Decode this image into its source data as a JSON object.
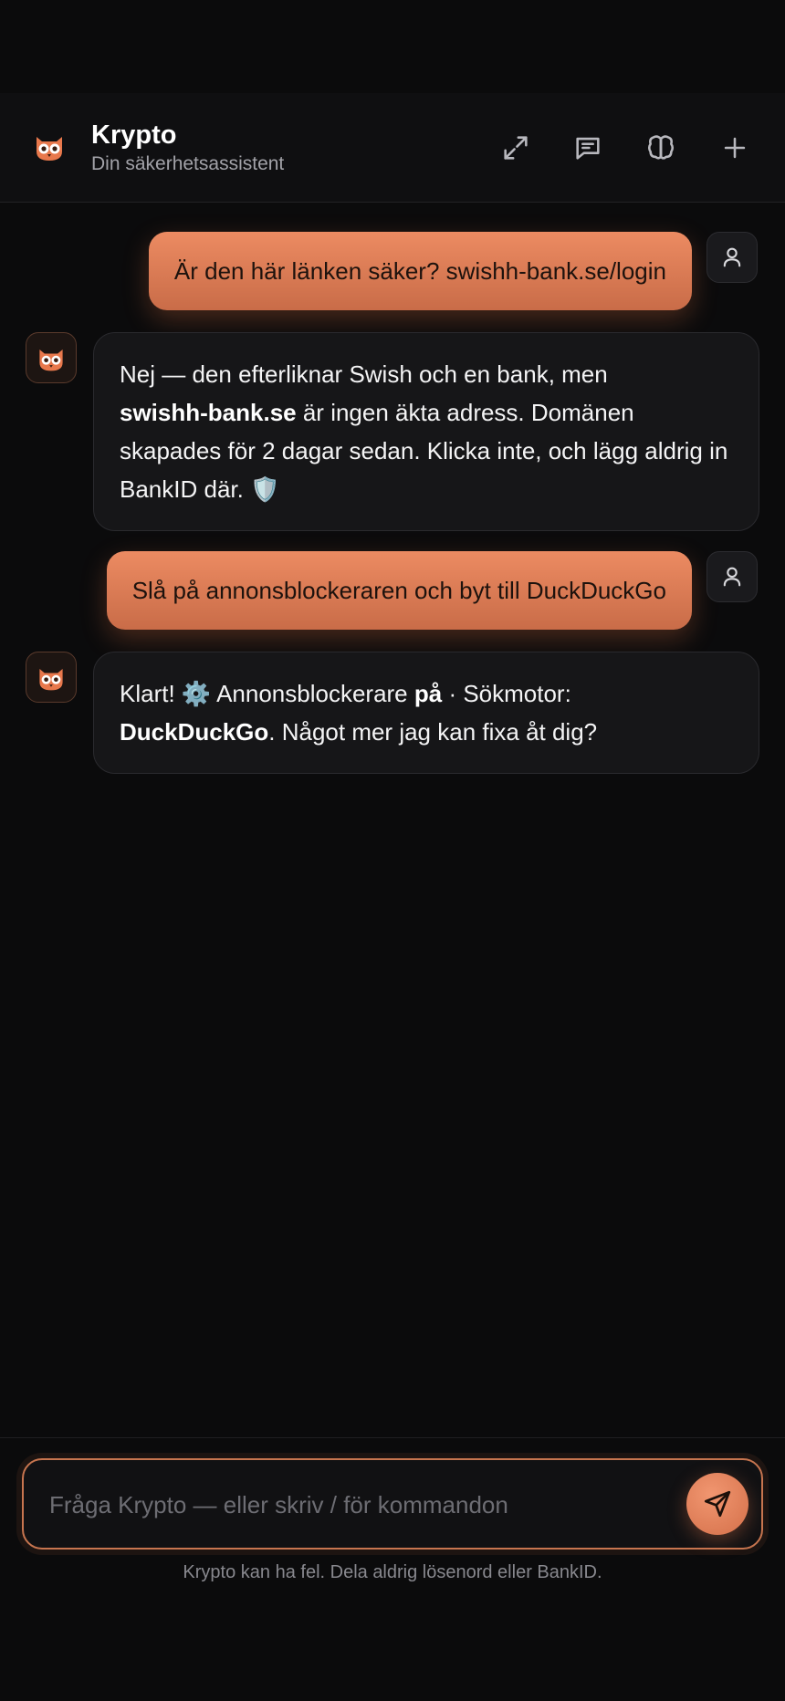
{
  "header": {
    "title": "Krypto",
    "subtitle": "Din säkerhetsassistent",
    "buttons": [
      "expand-icon",
      "chat-icon",
      "brain-icon",
      "plus-icon"
    ]
  },
  "messages": [
    {
      "role": "user",
      "text": "Är den här länken säker? swishh-bank.se/login"
    },
    {
      "role": "assistant",
      "parts": {
        "p1": "Nej — den efterliknar Swish och en bank, men",
        "bold1": "swishh-bank.se",
        "p2": " är ingen äkta adress. Domänen skapades för 2 dagar sedan. Klicka inte, och lägg aldrig in BankID där. 🛡️"
      }
    },
    {
      "role": "user",
      "text": "Slå på annonsblockeraren och byt till DuckDuckGo"
    },
    {
      "role": "assistant",
      "parts": {
        "p1": "Klart! ⚙️ Annonsblockerare ",
        "bold1": "på",
        "p2": " · Sökmotor: ",
        "bold2": "DuckDuckGo",
        "p3": ". Något mer jag kan fixa åt dig?"
      }
    }
  ],
  "composer": {
    "placeholder": "Fråga Krypto — eller skriv / för kommandon",
    "value": ""
  },
  "disclaimer": "Krypto kan ha fel. Dela aldrig lösenord eller BankID.",
  "colors": {
    "accent": "#e07a52",
    "background": "#0b0b0c",
    "bubble": "#161618"
  }
}
